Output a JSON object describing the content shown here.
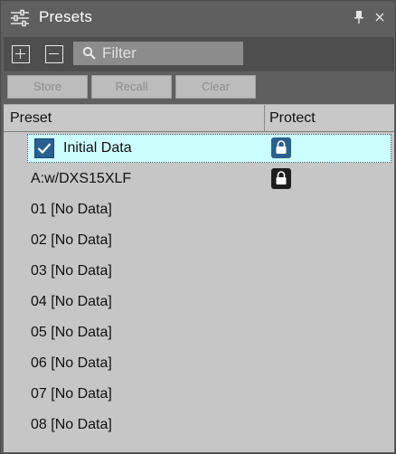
{
  "window": {
    "title": "Presets",
    "title_icon": "sliders-icon",
    "pin_icon": "pin-icon",
    "close_icon": "close-icon"
  },
  "toolbar": {
    "add_icon": "plus-box-icon",
    "remove_icon": "minus-box-icon",
    "filter_placeholder": "Filter",
    "filter_value": ""
  },
  "actions": {
    "store_label": "Store",
    "recall_label": "Recall",
    "clear_label": "Clear"
  },
  "table": {
    "columns": [
      "Preset",
      "Protect"
    ],
    "rows": [
      {
        "name": "Initial Data",
        "checked": true,
        "protected": true,
        "selected": true
      },
      {
        "name": "A:w/DXS15XLF",
        "checked": false,
        "protected": true,
        "selected": false
      },
      {
        "name": "01 [No Data]",
        "checked": false,
        "protected": false,
        "selected": false
      },
      {
        "name": "02 [No Data]",
        "checked": false,
        "protected": false,
        "selected": false
      },
      {
        "name": "03 [No Data]",
        "checked": false,
        "protected": false,
        "selected": false
      },
      {
        "name": "04 [No Data]",
        "checked": false,
        "protected": false,
        "selected": false
      },
      {
        "name": "05 [No Data]",
        "checked": false,
        "protected": false,
        "selected": false
      },
      {
        "name": "06 [No Data]",
        "checked": false,
        "protected": false,
        "selected": false
      },
      {
        "name": "07 [No Data]",
        "checked": false,
        "protected": false,
        "selected": false
      },
      {
        "name": "08 [No Data]",
        "checked": false,
        "protected": false,
        "selected": false
      }
    ]
  },
  "colors": {
    "window_bg": "#5f5f5f",
    "toolbar_bg": "#4e4e4e",
    "selection_bg": "#ccffff",
    "accent": "#2a5f8e"
  }
}
